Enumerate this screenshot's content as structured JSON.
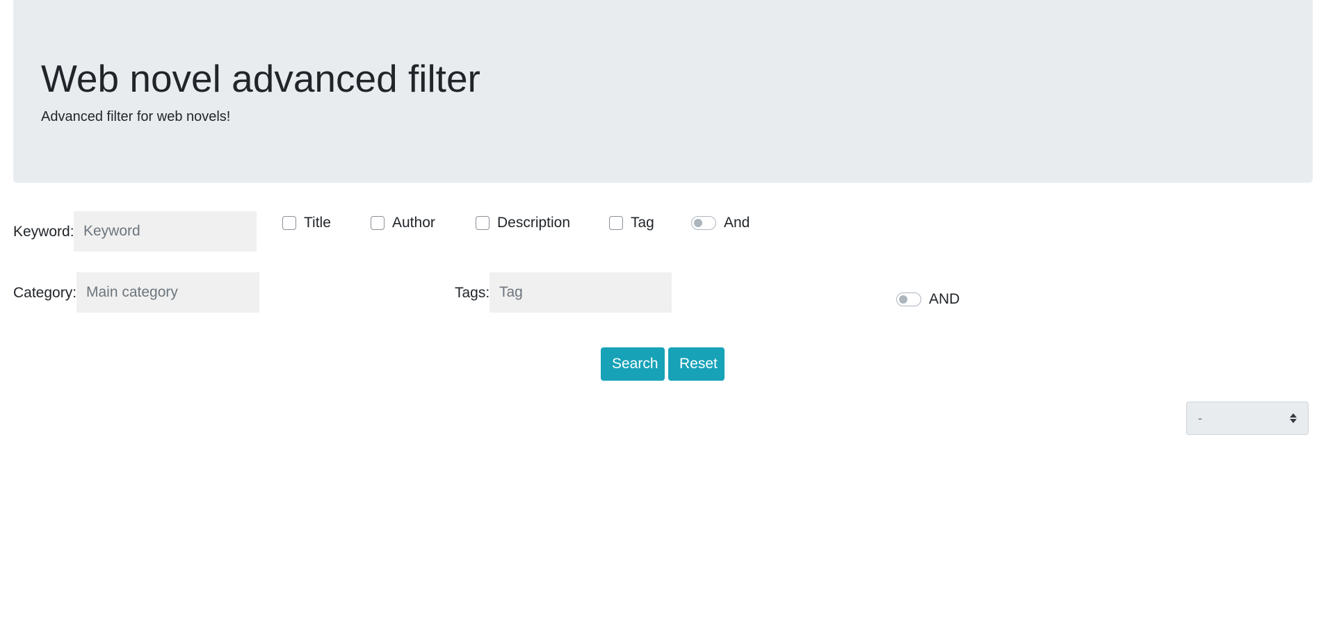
{
  "header": {
    "title": "Web novel advanced filter",
    "subtitle": "Advanced filter for web novels!"
  },
  "keyword_row": {
    "label": "Keyword:",
    "input_placeholder": "Keyword",
    "input_value": "",
    "checkboxes": [
      {
        "label": "Title",
        "checked": false
      },
      {
        "label": "Author",
        "checked": false
      },
      {
        "label": "Description",
        "checked": false
      },
      {
        "label": "Tag",
        "checked": false
      }
    ],
    "switch": {
      "label": "And",
      "on": false
    }
  },
  "category_row": {
    "category_label": "Category:",
    "category_placeholder": "Main category",
    "tags_label": "Tags:",
    "tags_placeholder": "Tag",
    "switch": {
      "label": "AND",
      "on": false
    }
  },
  "actions": {
    "search_label": "Search",
    "reset_label": "Reset"
  },
  "sort": {
    "selected": "-"
  },
  "colors": {
    "jumbotron_bg": "#e9ecef",
    "button_bg": "#17a2b8",
    "input_bg": "#f0f0f0"
  }
}
